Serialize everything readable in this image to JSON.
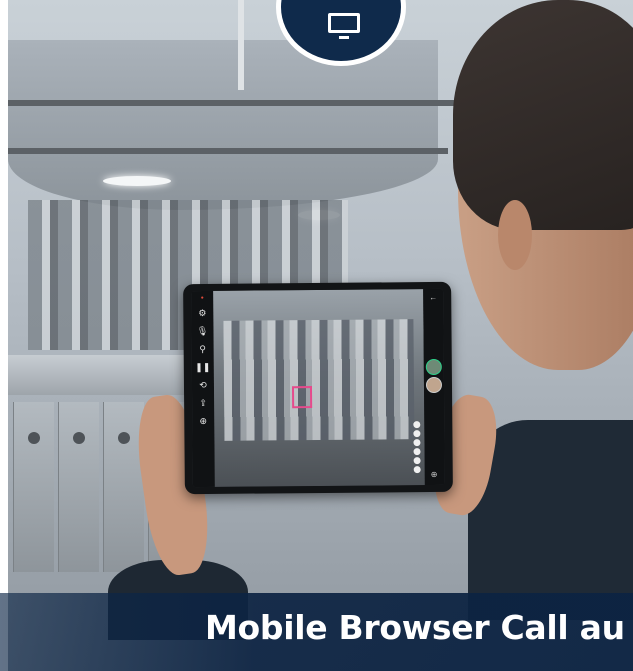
{
  "banner": {
    "title": "Mobile Browser Call au"
  },
  "badge": {
    "icon": "monitor-icon",
    "color": "#0f2a4b"
  },
  "tablet_ui": {
    "left_toolbar_icons": [
      "settings-icon",
      "microphone-icon",
      "flashlight-icon",
      "pause-icon",
      "camera-switch-icon",
      "share-icon",
      "zoom-icon"
    ],
    "right_panel_icons": [
      "back-arrow-icon",
      "participants-icon",
      "add-icon"
    ],
    "marker_color": "#e64a8c",
    "accent_color": "#2fd08a"
  },
  "colors": {
    "banner_bg": "#0c2342",
    "banner_text": "#ffffff"
  }
}
